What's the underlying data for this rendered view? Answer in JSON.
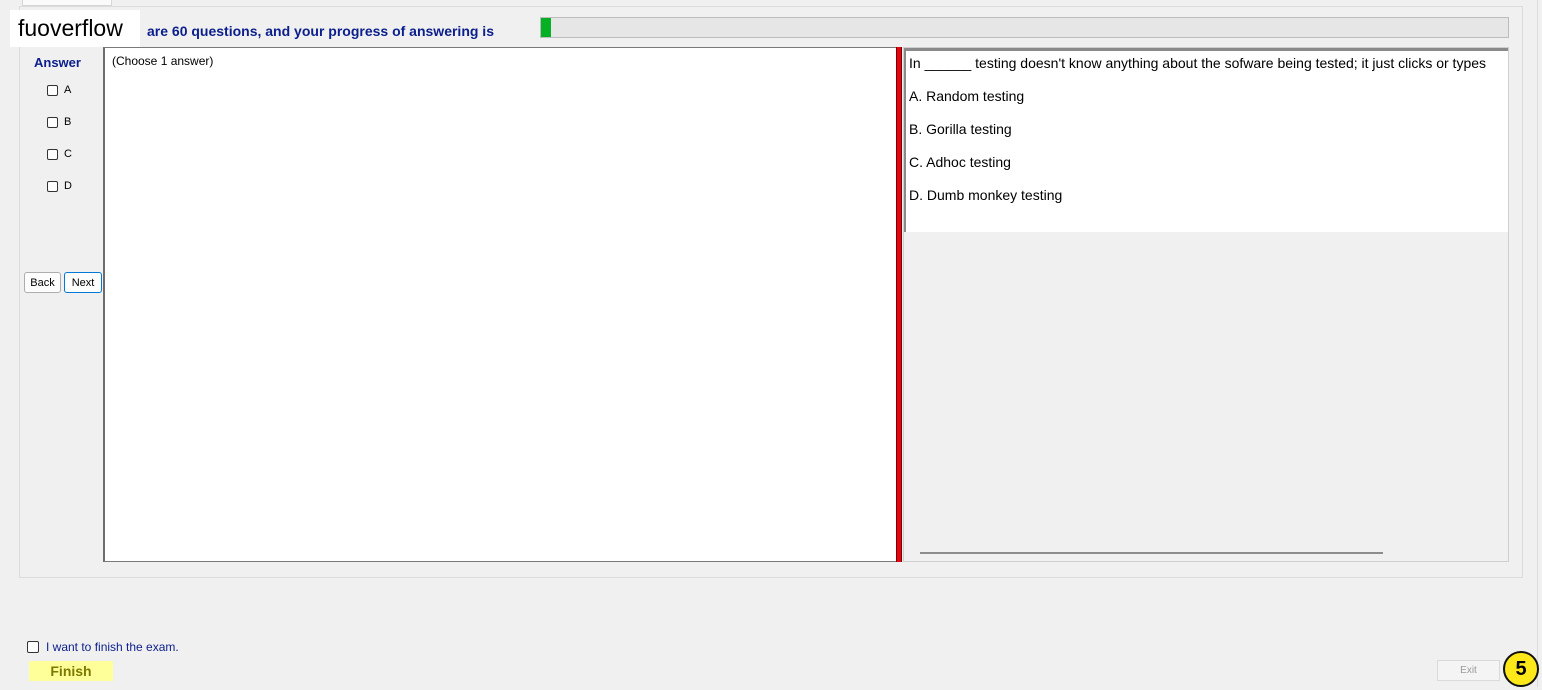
{
  "header": {
    "watermark": "fuoverflow",
    "progress_text": "are 60 questions, and your progress of answering is",
    "progress_fraction": 0.01
  },
  "answer_panel": {
    "label": "Answer",
    "options": [
      "A",
      "B",
      "C",
      "D"
    ],
    "back_label": "Back",
    "next_label": "Next",
    "instruction": "(Choose 1 answer)"
  },
  "question": {
    "text": "In ______ testing doesn't know anything about the sofware being tested; it just clicks or types",
    "choices": [
      "A.  Random testing",
      "B.  Gorilla testing",
      "C.  Adhoc testing",
      "D.  Dumb monkey testing"
    ]
  },
  "footer": {
    "finish_checkbox_label": "I want to finish the exam.",
    "finish_label": "Finish",
    "exit_label": "Exit",
    "badge_number": "5"
  },
  "colors": {
    "accent_text": "#0a1e8c",
    "progress_green": "#06b025",
    "splitter_red": "#e30613",
    "finish_bg": "#ffff99",
    "badge_yellow": "#ffe81a"
  }
}
